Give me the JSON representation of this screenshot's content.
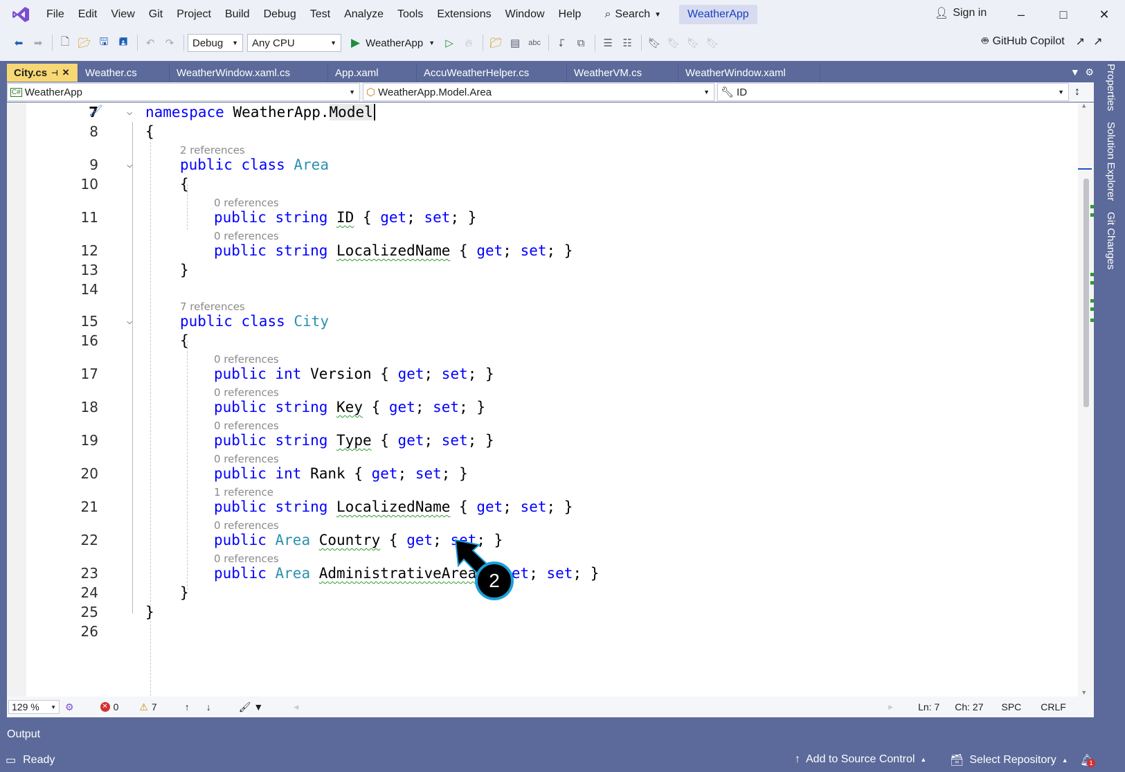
{
  "menu": {
    "items": [
      "File",
      "Edit",
      "View",
      "Git",
      "Project",
      "Build",
      "Debug",
      "Test",
      "Analyze",
      "Tools",
      "Extensions",
      "Window",
      "Help"
    ],
    "search_label": "Search",
    "solution_name": "WeatherApp",
    "sign_in_label": "Sign in"
  },
  "toolbar": {
    "configuration": "Debug",
    "platform": "Any CPU",
    "run_target": "WeatherApp",
    "copilot_label": "GitHub Copilot"
  },
  "tabs": [
    {
      "label": "City.cs",
      "active": true
    },
    {
      "label": "Weather.cs"
    },
    {
      "label": "WeatherWindow.xaml.cs"
    },
    {
      "label": "App.xaml"
    },
    {
      "label": "AccuWeatherHelper.cs"
    },
    {
      "label": "WeatherVM.cs"
    },
    {
      "label": "WeatherWindow.xaml"
    }
  ],
  "navbar": {
    "project": "WeatherApp",
    "type": "WeatherApp.Model.Area",
    "member": "ID"
  },
  "code": {
    "lines": {
      "n7": "7",
      "n8": "8",
      "n9": "9",
      "n10": "10",
      "n11": "11",
      "n12": "12",
      "n13": "13",
      "n14": "14",
      "n15": "15",
      "n16": "16",
      "n17": "17",
      "n18": "18",
      "n19": "19",
      "n20": "20",
      "n21": "21",
      "n22": "22",
      "n23": "23",
      "n24": "24",
      "n25": "25",
      "n26": "26"
    },
    "tokens": {
      "kw_namespace": "namespace",
      "ns_name": "WeatherApp.",
      "ns_model": "Model",
      "open_brace": "{",
      "close_brace": "}",
      "kw_public": "public",
      "kw_class": "class",
      "kw_string": "string",
      "kw_int": "int",
      "kw_get": "get",
      "kw_set": "set",
      "type_area": "Area",
      "type_city": "City",
      "prop_id": "ID",
      "prop_localized": "LocalizedName",
      "prop_version": "Version",
      "prop_key": "Key",
      "prop_type": "Type",
      "prop_rank": "Rank",
      "prop_country": "Country",
      "prop_admin": "AdministrativeArea",
      "accessor_tail": " { get; set; }"
    },
    "lens": {
      "refs_2": "2 references",
      "refs_0": "0 references",
      "refs_7": "7 references",
      "refs_1": "1 reference"
    }
  },
  "editor_status": {
    "zoom": "129 %",
    "errors": "0",
    "warnings": "7",
    "line": "Ln: 7",
    "column": "Ch: 27",
    "whitespace": "SPC",
    "line_ending": "CRLF"
  },
  "right_dock": {
    "properties": "Properties",
    "solution_explorer": "Solution Explorer",
    "git_changes": "Git Changes"
  },
  "output_label": "Output",
  "statusbar": {
    "ready": "Ready",
    "add_source_control": "Add to Source Control",
    "select_repository": "Select Repository",
    "notifications": "1"
  },
  "annotation": {
    "step": "2"
  },
  "colors": {
    "accent": "#5b6a9a",
    "active_tab": "#f7d874",
    "keyword": "#0000ff",
    "type": "#2b91af",
    "squiggle": "#2e9b2e",
    "annotation_ring": "#1ba0d8"
  }
}
